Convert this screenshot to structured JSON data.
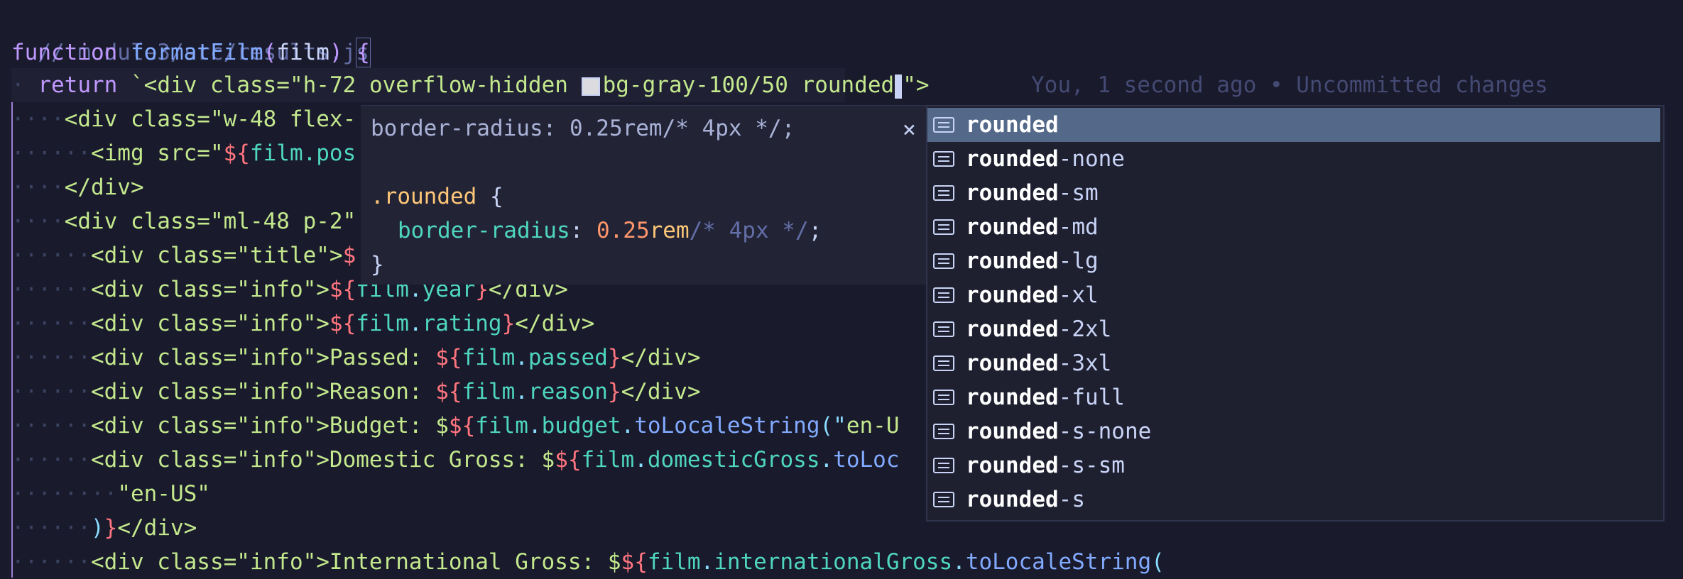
{
  "editor": {
    "file_comment": "// module3/src/results.js",
    "line_func": {
      "kw": "function",
      "name": "formatFilm",
      "open": "(",
      "param": "film",
      "close": ")",
      "brace": "{"
    },
    "line_return": {
      "kw": "return",
      "tick": "`",
      "text1": "<div class=\"h-72 overflow-hidden ",
      "text2": "bg-gray-100/50 rounded",
      "text3": "\">"
    },
    "blame": "You, 1 second ago • Uncommitted changes",
    "l4": "<div class=\"w-48 flex-",
    "l5a": "<img src=\"",
    "l5b": "${",
    "l5c": "film.pos",
    "l6": "</div>",
    "l7": "<div class=\"ml-48 p-2\"",
    "l8a": "<div class=\"title\">",
    "l8b": "$",
    "l9a": "<div class=\"info\">",
    "l9b": "${",
    "l9c": "film",
    "l9d": ".",
    "l9e": "year",
    "l9f": "}",
    "l9g": "</div>",
    "l10a": "<div class=\"info\">",
    "l10b": "${",
    "l10c": "film",
    "l10d": ".",
    "l10e": "rating",
    "l10f": "}",
    "l10g": "</div>",
    "l11a": "<div class=\"info\">Passed: ",
    "l11b": "${",
    "l11c": "film",
    "l11d": ".",
    "l11e": "passed",
    "l11f": "}",
    "l11g": "</div>",
    "l12a": "<div class=\"info\">Reason: ",
    "l12b": "${",
    "l12c": "film",
    "l12d": ".",
    "l12e": "reason",
    "l12f": "}",
    "l12g": "</div>",
    "l13a": "<div class=\"info\">Budget: $",
    "l13b": "${",
    "l13c": "film",
    "l13d": ".",
    "l13e": "budget",
    "l13f": ".",
    "l13g": "toLocaleString",
    "l13h": "(\"",
    "l13i": "en-U",
    "l14a": "<div class=\"info\">Domestic Gross: $",
    "l14b": "${",
    "l14c": "film",
    "l14d": ".",
    "l14e": "domesticGross",
    "l14f": ".",
    "l14g": "toLoc",
    "l15": "\"en-US\"",
    "l16a": ")",
    "l16b": "}",
    "l16c": "</div>",
    "l17a": "<div class=\"info\">International Gross: $",
    "l17b": "${",
    "l17c": "film",
    "l17d": ".",
    "l17e": "internationalGross",
    "l17f": ".",
    "l17g": "toLocaleString",
    "l17h": "("
  },
  "hover": {
    "signature": "border-radius: 0.25rem/* 4px */;",
    "close": "×",
    "selector": ".rounded",
    "open_brace": "{",
    "prop": "border-radius",
    "colon": ":",
    "num": "0.25",
    "unit": "rem",
    "comment": "/* 4px */",
    "semi": ";",
    "close_brace": "}"
  },
  "completion": {
    "match": "rounded",
    "items": [
      "",
      "-none",
      "-sm",
      "-md",
      "-lg",
      "-xl",
      "-2xl",
      "-3xl",
      "-full",
      "-s-none",
      "-s-sm",
      "-s"
    ],
    "item_icon": "text-icon"
  },
  "colors": {
    "background": "#191a2b",
    "selection": "#54698a",
    "keyword": "#c099ff",
    "function": "#82aaff",
    "string": "#c3e88d",
    "interp": "#ff757f"
  }
}
